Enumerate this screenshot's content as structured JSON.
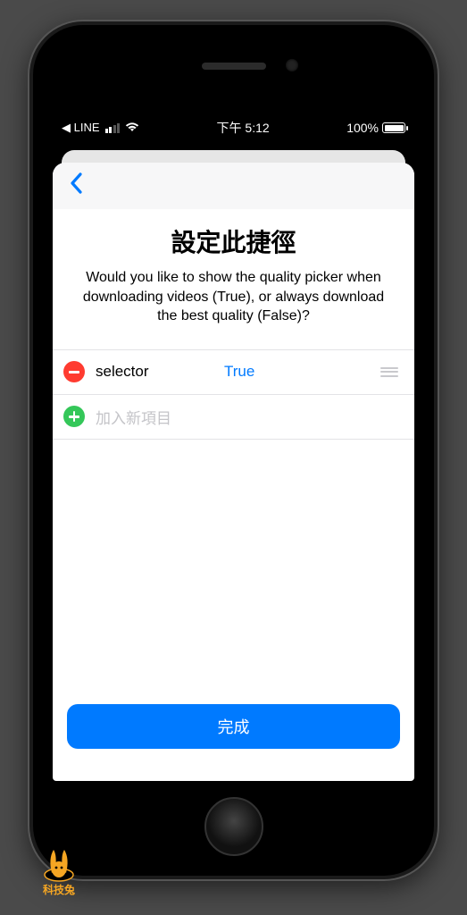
{
  "statusbar": {
    "back_app": "LINE",
    "time": "下午 5:12",
    "battery_pct": "100%"
  },
  "sheet": {
    "title": "設定此捷徑",
    "description": "Would you like to show the quality picker when downloading videos (True), or always download the best quality (False)?",
    "rows": [
      {
        "key": "selector",
        "value": "True"
      }
    ],
    "add_row_placeholder": "加入新項目",
    "done_label": "完成"
  },
  "watermark": {
    "label": "科技兔"
  }
}
